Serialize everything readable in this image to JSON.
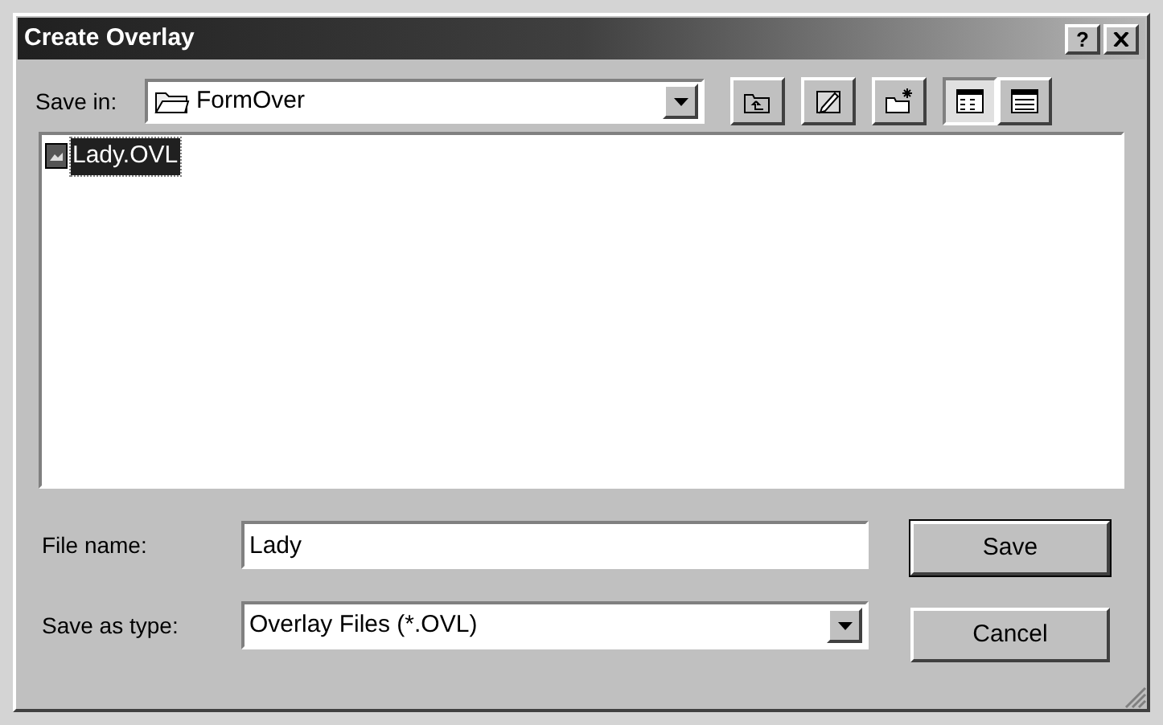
{
  "window": {
    "title": "Create Overlay",
    "title_buttons": [
      "?"
    ]
  },
  "save_in": {
    "label": "Save in:",
    "value": "FormOver"
  },
  "toolbar": [
    {
      "kind": "up",
      "selected": false
    },
    {
      "kind": "desktop",
      "selected": false
    },
    {
      "kind": "newfolder",
      "selected": false
    },
    {
      "kind": "list",
      "selected": true
    },
    {
      "kind": "details",
      "selected": false
    }
  ],
  "files": [
    {
      "name": "Lady.OVL",
      "selected": true
    }
  ],
  "file_name": {
    "label": "File name:",
    "value": "Lady"
  },
  "save_as_type": {
    "label": "Save as type:",
    "value": "Overlay Files (*.OVL)"
  },
  "buttons": [
    {
      "label": "Save",
      "default": true
    },
    {
      "label": "Cancel",
      "default": false
    }
  ]
}
